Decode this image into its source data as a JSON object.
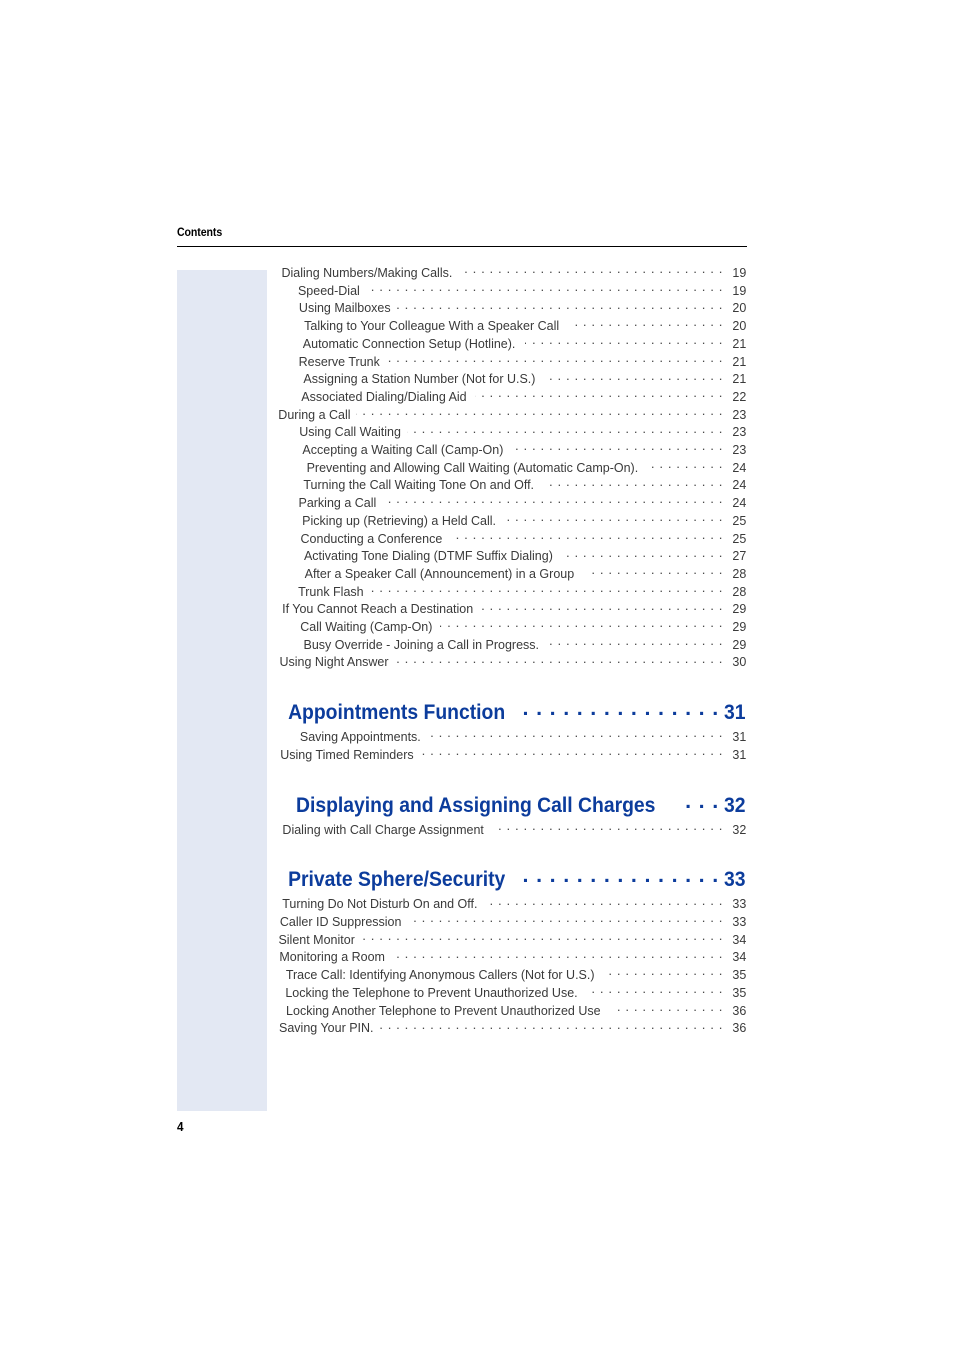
{
  "header": {
    "title": "Contents"
  },
  "folio": {
    "page_number": "4"
  },
  "toc": {
    "blocks": [
      {
        "kind": "entry",
        "level": 1,
        "label": "Dialing Numbers/Making Calls.",
        "page": "19"
      },
      {
        "kind": "entry",
        "level": 2,
        "label": "Speed-Dial",
        "page": "19"
      },
      {
        "kind": "entry",
        "level": 2,
        "label": "Using Mailboxes",
        "page": "20"
      },
      {
        "kind": "entry",
        "level": 2,
        "label": "Talking to Your Colleague With a Speaker Call",
        "page": "20"
      },
      {
        "kind": "entry",
        "level": 2,
        "label": "Automatic Connection Setup (Hotline).",
        "page": "21"
      },
      {
        "kind": "entry",
        "level": 2,
        "label": "Reserve Trunk",
        "page": "21"
      },
      {
        "kind": "entry",
        "level": 2,
        "label": "Assigning a Station Number (Not for U.S.)",
        "page": "21"
      },
      {
        "kind": "entry",
        "level": 2,
        "label": "Associated Dialing/Dialing Aid",
        "page": "22"
      },
      {
        "kind": "entry",
        "level": 1,
        "label": "During a Call",
        "page": "23"
      },
      {
        "kind": "entry",
        "level": 2,
        "label": "Using Call Waiting",
        "page": "23"
      },
      {
        "kind": "entry",
        "level": 2,
        "label": "Accepting a Waiting Call (Camp-On)",
        "page": "23"
      },
      {
        "kind": "entry",
        "level": 2,
        "label": "Preventing and Allowing Call Waiting (Automatic Camp-On).",
        "page": "24"
      },
      {
        "kind": "entry",
        "level": 2,
        "label": "Turning the Call Waiting Tone On and Off.",
        "page": "24"
      },
      {
        "kind": "entry",
        "level": 2,
        "label": "Parking a Call",
        "page": "24"
      },
      {
        "kind": "entry",
        "level": 2,
        "label": "Picking up (Retrieving) a Held Call.",
        "page": "25"
      },
      {
        "kind": "entry",
        "level": 2,
        "label": "Conducting a Conference",
        "page": "25"
      },
      {
        "kind": "entry",
        "level": 2,
        "label": "Activating Tone Dialing (DTMF Suffix Dialing)",
        "page": "27"
      },
      {
        "kind": "entry",
        "level": 2,
        "label": "After a Speaker Call (Announcement) in a Group",
        "page": "28"
      },
      {
        "kind": "entry",
        "level": 2,
        "label": "Trunk Flash",
        "page": "28"
      },
      {
        "kind": "entry",
        "level": 1,
        "label": "If You Cannot Reach a Destination",
        "page": "29"
      },
      {
        "kind": "entry",
        "level": 2,
        "label": "Call Waiting (Camp-On)",
        "page": "29"
      },
      {
        "kind": "entry",
        "level": 2,
        "label": "Busy Override - Joining a Call in Progress.",
        "page": "29"
      },
      {
        "kind": "entry",
        "level": 1,
        "label": "Using Night Answer",
        "page": "30"
      },
      {
        "kind": "chapter",
        "label": "Appointments Function",
        "page": "31"
      },
      {
        "kind": "entry",
        "level": 2,
        "label": "Saving Appointments.",
        "page": "31"
      },
      {
        "kind": "entry",
        "level": 1,
        "label": "Using Timed Reminders",
        "page": "31"
      },
      {
        "kind": "chapter",
        "label": "Displaying and Assigning Call Charges",
        "page": "32"
      },
      {
        "kind": "entry",
        "level": 1,
        "label": "Dialing with Call Charge Assignment",
        "page": "32"
      },
      {
        "kind": "chapter",
        "label": "Private Sphere/Security",
        "page": "33"
      },
      {
        "kind": "entry",
        "level": 1,
        "label": "Turning Do Not Disturb On and Off.",
        "page": "33"
      },
      {
        "kind": "entry",
        "level": 1,
        "label": "Caller ID Suppression",
        "page": "33"
      },
      {
        "kind": "entry",
        "level": 1,
        "label": "Silent Monitor",
        "page": "34"
      },
      {
        "kind": "entry",
        "level": 1,
        "label": "Monitoring a Room",
        "page": "34"
      },
      {
        "kind": "entry",
        "level": 1,
        "label": "Trace Call: Identifying Anonymous Callers (Not for U.S.)",
        "page": "35"
      },
      {
        "kind": "entry",
        "level": 1,
        "label": "Locking the Telephone to Prevent Unauthorized Use.",
        "page": "35"
      },
      {
        "kind": "entry",
        "level": 1,
        "label": "Locking Another Telephone to Prevent Unauthorized Use",
        "page": "36"
      },
      {
        "kind": "entry",
        "level": 1,
        "label": "Saving Your PIN.",
        "page": "36"
      }
    ]
  },
  "colors": {
    "chapter_blue": "#0c3c9c",
    "side_tab": "#e3e8f3",
    "body_text": "#3a3a3a"
  }
}
